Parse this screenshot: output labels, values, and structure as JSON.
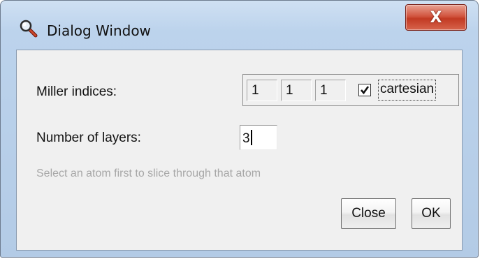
{
  "window": {
    "title": "Dialog Window",
    "icon": "magnifier-icon",
    "close_glyph": "X"
  },
  "form": {
    "miller_label": "Miller indices:",
    "miller_values": [
      "1",
      "1",
      "1"
    ],
    "cartesian_label": "cartesian",
    "cartesian_checked": true,
    "layers_label": "Number of layers:",
    "layers_value": "3",
    "hint": "Select an atom first to slice through that atom"
  },
  "buttons": {
    "close_label": "Close",
    "ok_label": "OK"
  },
  "colors": {
    "close_button": "#c9452d",
    "hint_text": "#a7a7a7",
    "panel_bg": "#f0f0f0"
  }
}
